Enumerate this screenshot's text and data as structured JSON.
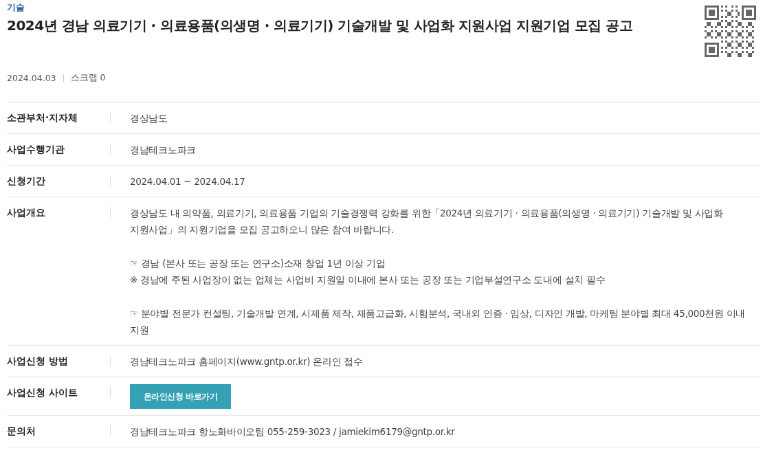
{
  "category": "기술",
  "title": "2024년 경남 의료기기 · 의료용품(의생명 · 의료기기) 기술개발 및 사업화 지원사업 지원기업 모집 공고",
  "date": "2024.04.03",
  "scrap": "스크랩 0",
  "rows": [
    {
      "kind": "text",
      "label": "소관부처·지자체",
      "value": "경상남도"
    },
    {
      "kind": "text",
      "label": "사업수행기관",
      "value": "경남테크노파크"
    },
    {
      "kind": "text",
      "label": "신청기간",
      "value": "2024.04.01 ~ 2024.04.17"
    },
    {
      "kind": "paragraphs",
      "label": "사업개요",
      "groups": [
        [
          "경상남도 내 의약품, 의료기기, 의료용품 기업의 기술경쟁력 강화를 위한「2024년 의료기기 · 의료용품(의생명 · 의료기기) 기술개발 및 사업화 지원사업」의 지원기업을 모집 공고하오니 많은 참여 바랍니다."
        ],
        [
          "☞ 경남 (본사 또는 공장 또는 연구소)소재 창업 1년 이상 기업",
          "※ 경남에 주된 사업장이 없는 업체는 사업비 지원일 이내에 본사 또는 공장 또는 기업부설연구소 도내에 설치 필수"
        ],
        [
          "☞ 분야별 전문가 컨설팅, 기술개발 연계, 시제품 제작, 제품고급화, 시험분석, 국내외 인증 · 임상, 디자인 개발, 마케팅 분야별 최대 45,000천원 이내 지원"
        ]
      ]
    },
    {
      "kind": "text",
      "label": "사업신청 방법",
      "value": "경남테크노파크 홈페이지(www.gntp.or.kr) 온라인 접수"
    },
    {
      "kind": "button",
      "label": "사업신청 사이트",
      "button": "온라인신청 바로가기"
    },
    {
      "kind": "text",
      "label": "문의처",
      "value": "경남테크노파크 항노화바이오팀 055-259-3023 / jamiekim6179@gntp.or.kr"
    }
  ]
}
